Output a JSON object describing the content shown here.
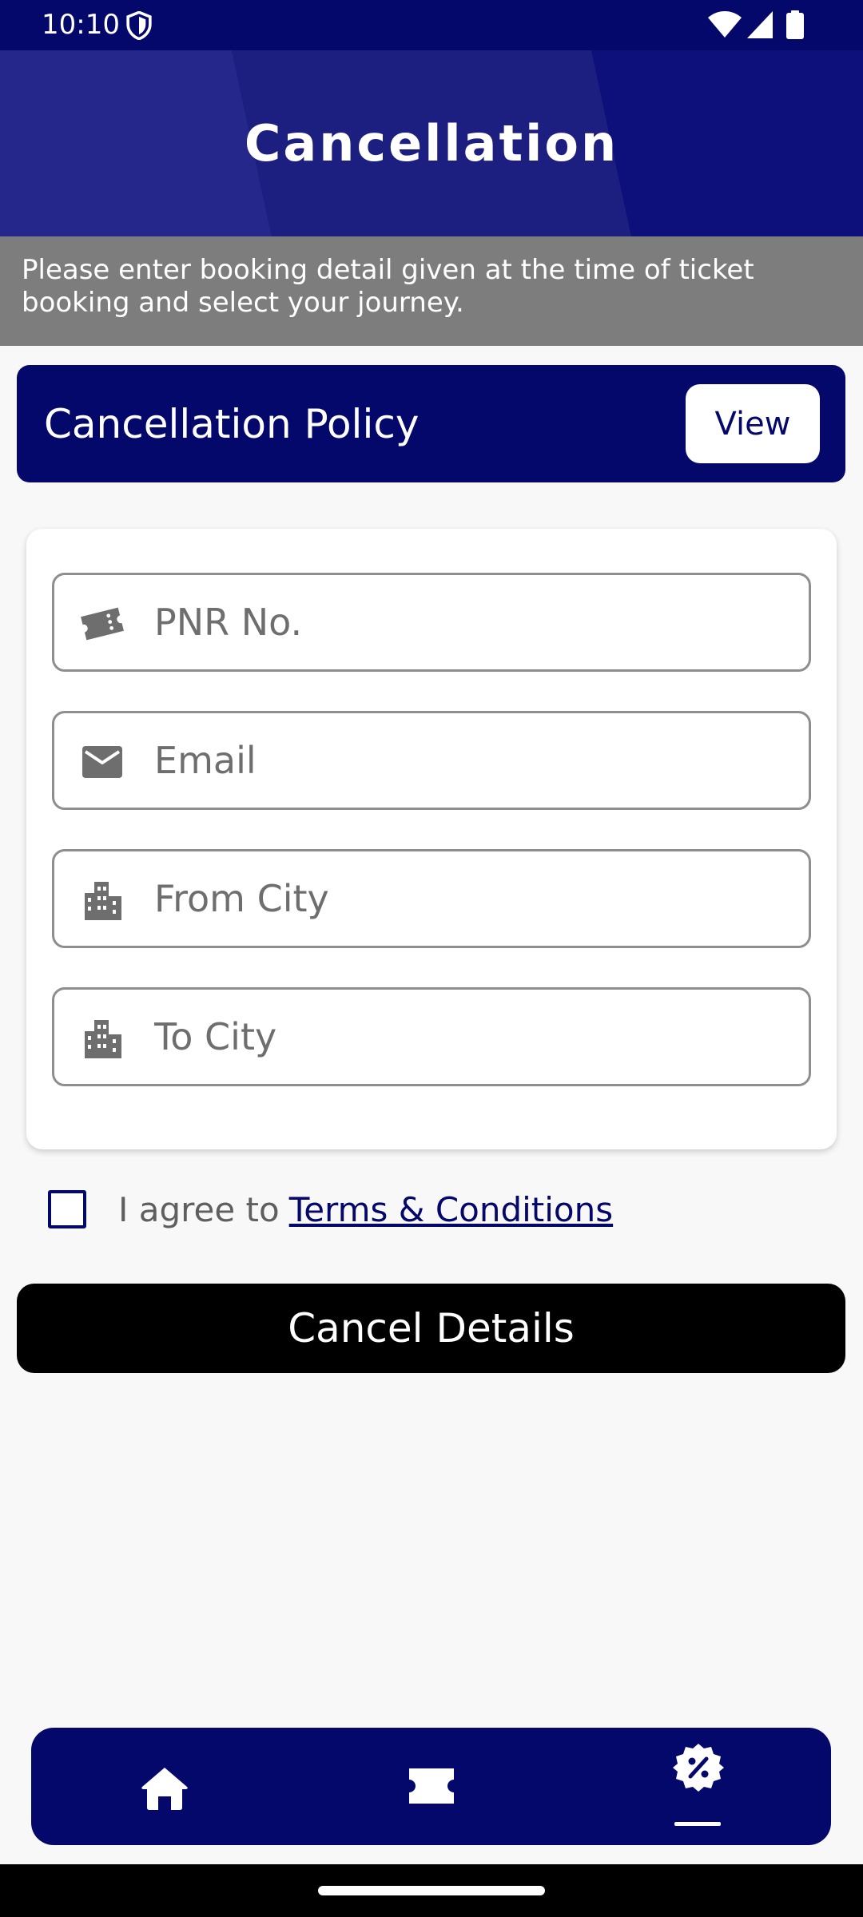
{
  "status_bar": {
    "time": "10:10",
    "icons": [
      "shield-icon",
      "wifi-icon",
      "signal-icon",
      "battery-icon"
    ]
  },
  "header": {
    "title": "Cancellation"
  },
  "info_banner": {
    "text": "Please enter booking detail given at the time of ticket booking and select your journey."
  },
  "policy": {
    "title": "Cancellation Policy",
    "view_label": "View"
  },
  "form": {
    "pnr": {
      "placeholder": "PNR No.",
      "value": "",
      "icon": "ticket-icon"
    },
    "email": {
      "placeholder": "Email",
      "value": "",
      "icon": "mail-icon"
    },
    "from_city": {
      "placeholder": "From City",
      "value": "",
      "icon": "city-icon"
    },
    "to_city": {
      "placeholder": "To City",
      "value": "",
      "icon": "city-icon"
    }
  },
  "terms": {
    "prefix": "I agree to",
    "link": "Terms & Conditions",
    "checked": false
  },
  "cancel_button_label": "Cancel Details",
  "bottom_nav": {
    "items": [
      {
        "icon": "home-icon",
        "active": false
      },
      {
        "icon": "ticket-icon",
        "active": false
      },
      {
        "icon": "discount-icon",
        "active": true
      }
    ]
  },
  "colors": {
    "primary": "#05086b",
    "banner": "#7d7d7d",
    "button": "#000000",
    "background": "#f8f8f8"
  }
}
